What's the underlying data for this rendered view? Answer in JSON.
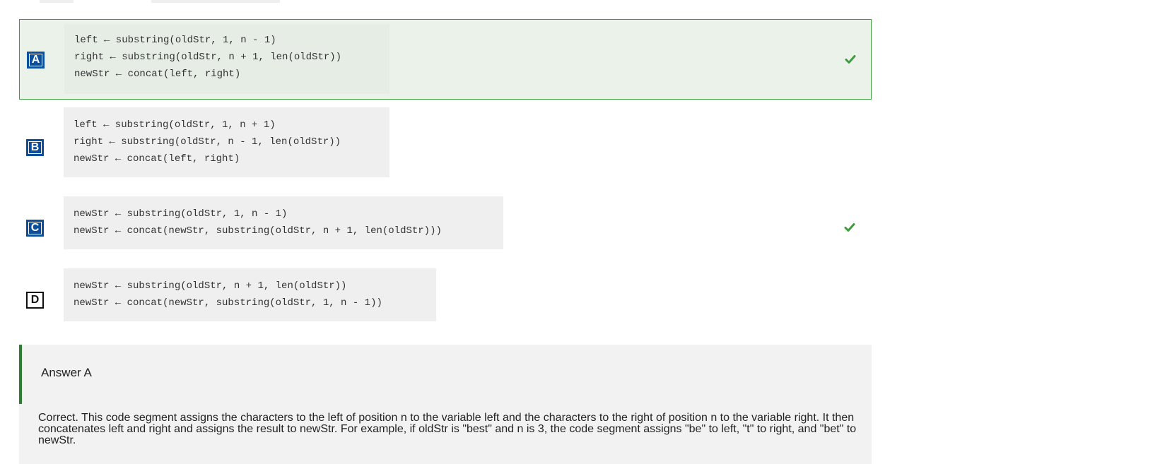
{
  "options": [
    {
      "letter": "A",
      "lines": [
        "left ← substring(oldStr, 1, n - 1)",
        "right ← substring(oldStr, n + 1, len(oldStr))",
        "newStr ← concat(left, right)"
      ],
      "selected": true,
      "correct": true
    },
    {
      "letter": "B",
      "lines": [
        "left ← substring(oldStr, 1, n + 1)",
        "right ← substring(oldStr, n - 1, len(oldStr))",
        "newStr ← concat(left, right)"
      ],
      "selected": false,
      "correct": false
    },
    {
      "letter": "C",
      "lines": [
        "newStr ← substring(oldStr, 1, n - 1)",
        "newStr ← concat(newStr, substring(oldStr, n + 1, len(oldStr)))"
      ],
      "selected": false,
      "correct": true
    },
    {
      "letter": "D",
      "lines": [
        "newStr ← substring(oldStr, n + 1, len(oldStr))",
        "newStr ← concat(newStr, substring(oldStr, 1, n - 1))"
      ],
      "selected": false,
      "correct": false
    }
  ],
  "icons": {
    "check": "check-icon"
  },
  "colors": {
    "letter_fill": "#0b4f9c",
    "correct_green": "#3e9b3e",
    "selected_bg": "#ebf2ea",
    "code_bg": "#efefef",
    "explanation_bar": "#2f7d32"
  },
  "explanation": {
    "heading": "Answer A",
    "text": "Correct. This code segment assigns the characters to the left of position  n  to the variable  left  and the characters to the right of position  n  to the variable  right.  It then concatenates  left  and  right  and assigns the result to  newStr.  For example, if  oldStr  is  \"best\"  and  n  is  3,  the code segment assigns  \"be\"  to  left,  \"t\"  to  right,  and  \"bet\"  to  newStr."
  }
}
